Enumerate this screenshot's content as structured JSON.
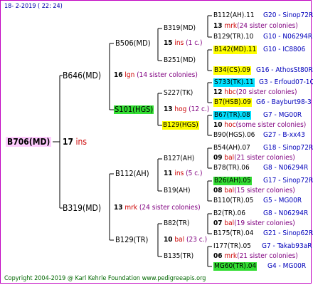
{
  "header": {
    "date": "18-  2-2019 ( 22: 24)"
  },
  "footer": {
    "copyright": "Copyright 2004-2019 @ Karl Kehrle Foundation    www.pedigreeapis.org"
  },
  "root": {
    "label": "B706(MD)",
    "number": "17",
    "ins": "ins"
  },
  "gen1": [
    {
      "label": "B646(MD)",
      "number": "16",
      "ins": "lgn",
      "note": "(14 sister colonies)"
    },
    {
      "label": "B319(MD)",
      "number": "13",
      "ins": "mrk",
      "note": "(24 sister colonies)"
    }
  ],
  "gen2": [
    {
      "label": "B506(MD)",
      "number": "15",
      "ins": "ins",
      "note": "(1 c.)"
    },
    {
      "label": "S101(HGS)",
      "number": "13",
      "ins": "hog",
      "note": "(12 c.)"
    },
    {
      "label": "B112(AH)",
      "number": "11",
      "ins": "ins",
      "note": "(5 c.)"
    },
    {
      "label": "B129(TR)",
      "number": "10",
      "ins": "bal",
      "note": "(23 c.)"
    }
  ],
  "gen3": [
    {
      "label": "B319(MD)",
      "number": "13",
      "ins": "mrk",
      "note": "(24 sister colonies)"
    },
    {
      "label": "B251(MD)"
    },
    {
      "label": "S227(TK)",
      "number": "12",
      "ins": "hbc",
      "note": "(20 sister colonies)"
    },
    {
      "label": "B129(HGS)",
      "number": "10",
      "ins": "hoc",
      "note": "(some sister colonies)"
    },
    {
      "label": "B127(AH)",
      "number": "09",
      "ins": "bal",
      "note": "(21 sister colonies)"
    },
    {
      "label": "B19(AH)",
      "number": "08",
      "ins": "bal",
      "note": "(15 sister colonies)"
    },
    {
      "label": "B82(TR)",
      "number": "07",
      "ins": "bal",
      "note": "(19 sister colonies)"
    },
    {
      "label": "B135(TR)",
      "number": "06",
      "ins": "mrk",
      "note": "(21 sister colonies)"
    }
  ],
  "gen4": [
    {
      "label": "B112(AH).11",
      "code": "G20 - Sinop72R"
    },
    {
      "label": "B129(TR).10",
      "code": "G10 - N06294R"
    },
    {
      "label": "B142(MD).11",
      "code": "G10 - IC8806"
    },
    {
      "label": "B34(CS).09",
      "code": "G16 - AthosSt80R"
    },
    {
      "label": "S733(TK).11",
      "code": "G3 - Erfoud07-1Q"
    },
    {
      "label": "B7(HSB).09",
      "code": "G6 - Bayburt98-3"
    },
    {
      "label": "B67(TR).08",
      "code": "G7 - MG00R"
    },
    {
      "label": "B90(HGS).06",
      "code": "G27 - B-xx43"
    },
    {
      "label": "B54(AH).07",
      "code": "G18 - Sinop72R"
    },
    {
      "label": "B78(TR).06",
      "code": "G8 - N06294R"
    },
    {
      "label": "B26(AH).05",
      "code": "G17 - Sinop72R"
    },
    {
      "label": "B110(TR).05",
      "code": "G5 - MG00R"
    },
    {
      "label": "B2(TR).06",
      "code": "G8 - N06294R"
    },
    {
      "label": "B175(TR).04",
      "code": "G21 - Sinop62R"
    },
    {
      "label": "I177(TR).05",
      "code": "G7 - Takab93aR"
    },
    {
      "label": "MG60(TR).04",
      "code": "G4 - MG00R"
    }
  ]
}
